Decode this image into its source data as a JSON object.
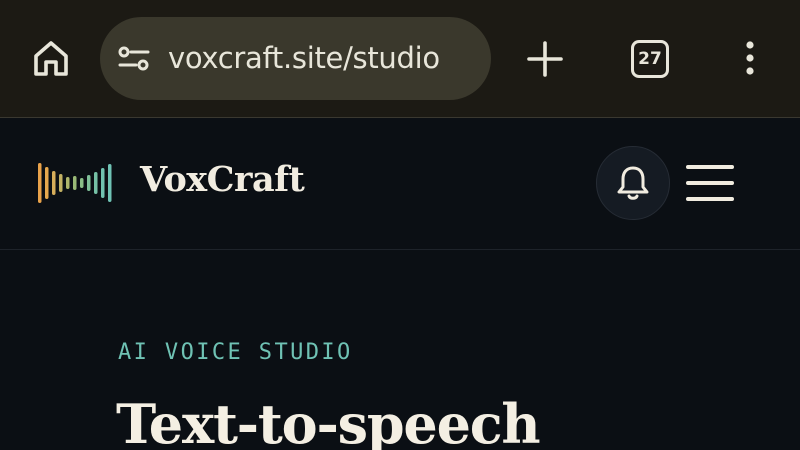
{
  "browser": {
    "url": "voxcraft.site/studio",
    "tab_count": "27",
    "icons": {
      "home": "home-icon",
      "site_settings": "tune-icon",
      "new_tab": "plus-icon",
      "tabs": "tab-switcher-icon",
      "menu": "more-vert-icon"
    }
  },
  "header": {
    "brand": "VoxCraft",
    "icons": {
      "logo": "waveform-logo",
      "notifications": "bell-icon",
      "menu": "hamburger-icon"
    }
  },
  "hero": {
    "eyebrow": "AI VOICE STUDIO",
    "title": "Text-to-speech"
  },
  "colors": {
    "chrome_bg": "#1c1a14",
    "page_bg": "#0b0f14",
    "accent_teal": "#6fc2b4",
    "accent_orange": "#e9a24a",
    "text_light": "#f1ece0"
  }
}
